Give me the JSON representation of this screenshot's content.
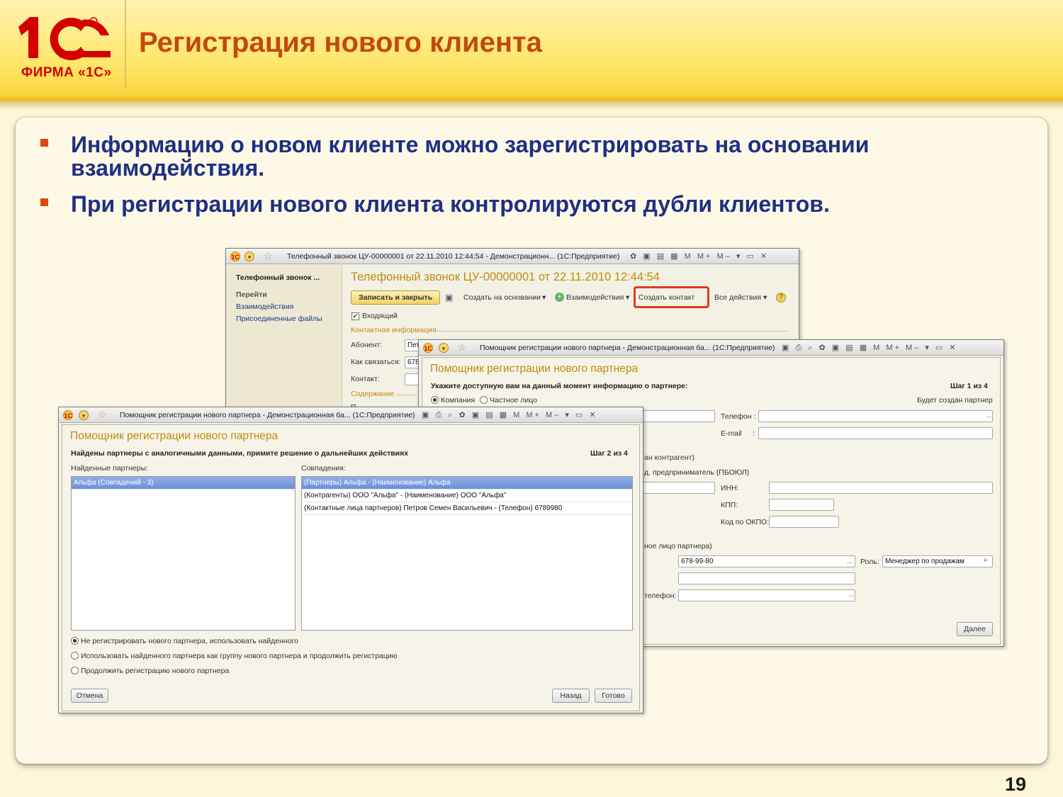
{
  "slide": {
    "title": "Регистрация нового клиента",
    "logo_text": "ФИРМА «1С»",
    "page_number": "19",
    "bullets": [
      "Информацию о новом клиенте можно зарегистрировать на основании взаимодействия.",
      "При регистрации нового клиента контролируются дубли клиентов."
    ]
  },
  "colors": {
    "title": "#c24a0c",
    "bullet_text": "#1f2f85",
    "bullet_mark": "#d64a10",
    "header_bg": "#ffe566",
    "highlight": "#e03a1a"
  },
  "win1": {
    "title": "Телефонный звонок ЦУ-00000001 от 22.11.2010 12:44:54 - Демонстрационн... (1С:Предприятие)",
    "nav_title": "Телефонный звонок ...",
    "nav_goto": "Перейти",
    "nav_items": [
      "Взаимодействия",
      "Присоединенные файлы"
    ],
    "heading": "Телефонный звонок ЦУ-00000001 от 22.11.2010 12:44:54",
    "btn_save_close": "Записать и закрыть",
    "btn_create_based": "Создать на основании",
    "btn_interactions": "Взаимодействия",
    "btn_create_contact": "Создать контакт",
    "btn_all_actions": "Все действия",
    "incoming_label": "Входящий",
    "contact_info_section": "Контактная информация",
    "label_subscriber": "Абонент:",
    "label_how_to_contact": "Как связаться:",
    "label_contact": "Контакт:",
    "value_subscriber": "Пет",
    "value_how": "678",
    "content_section": "Содержание",
    "label_cut": "П"
  },
  "win2": {
    "title": "Помощник регистрации нового партнера - Демонстрационная ба... (1С:Предприятие)",
    "heading": "Помощник регистрации нового партнера",
    "prompt": "Укажите доступную вам на данный момент информацию о партнере:",
    "step": "Шаг 1 из 4",
    "radio_company": "Компания",
    "radio_private": "Частное лицо",
    "will_create": "Будет создан партнер",
    "label_phone": "Телефон :",
    "label_email": "E-mail",
    "email_colon": ":",
    "partial_counterparty": "ан контрагент)",
    "partial_entrepreneur": "д. предприниматель (ПБОЮЛ)",
    "label_inn": "ИНН:",
    "label_kpp": "КПП:",
    "label_okpo": "Код по ОКПО:",
    "partial_contact": "ное лицо партнера)",
    "contact_phone_value": "678-99-80",
    "label_role": "Роль:",
    "role_value": "Менеджер по продажам",
    "partial_phone": "телефон:",
    "btn_next": "Далее"
  },
  "win3": {
    "title": "Помощник регистрации нового партнера - Демонстрационная ба... (1С:Предприятие)",
    "heading": "Помощник регистрации нового партнера",
    "prompt": "Найдены партнеры с аналогичными данными, примите решение о дальнейших действиях",
    "step": "Шаг 2 из 4",
    "found_label": "Найденные партнеры:",
    "matches_label": "Совпадения:",
    "found_items": [
      "Альфа (Совпадений - 3)"
    ],
    "matches": [
      "(Партнеры) Альфа - (Наименование) Альфа",
      "(Контрагенты) ООО \"Альфа\" - (Наименование) ООО \"Альфа\"",
      "(Контактные лица партнеров) Петров Семен Васильевич - (Телефон) 6789980"
    ],
    "options": [
      "Не регистрировать нового партнера, использовать найденного",
      "Использовать найденного партнера как группу нового партнера и продолжить регистрацию",
      "Продолжить регистрацию нового партнера"
    ],
    "btn_cancel": "Отмена",
    "btn_back": "Назад",
    "btn_done": "Готово"
  }
}
